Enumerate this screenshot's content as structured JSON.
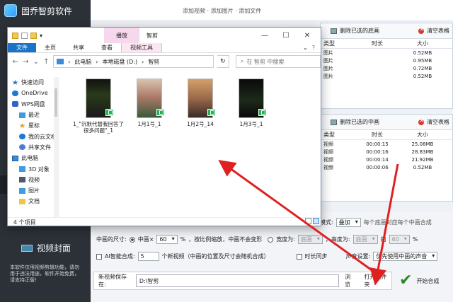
{
  "app": {
    "title": "固乔智剪软件",
    "top_text": "添加视频 · 添加图片 · 添加文件",
    "video_cover_label": "视频封面",
    "side_note": "本软件仅用视频剪辑功能，请勿用于违法用途，软件开始免费，请支持正版!"
  },
  "panel1": {
    "delete_label": "删除已选的底画",
    "clear_label": "清空表格",
    "headers": [
      "类型",
      "时长",
      "大小"
    ],
    "rows": [
      {
        "type": "图片",
        "duration": "",
        "size": "0.52MB"
      },
      {
        "type": "图片",
        "duration": "",
        "size": "0.95MB"
      },
      {
        "type": "图片",
        "duration": "",
        "size": "0.72MB"
      },
      {
        "type": "图片",
        "duration": "",
        "size": "0.52MB"
      }
    ]
  },
  "panel2": {
    "delete_label": "删除已选的中画",
    "clear_label": "清空表格",
    "headers": [
      "类型",
      "时长",
      "大小"
    ],
    "rows": [
      {
        "type": "视频",
        "duration": "00:00:15",
        "size": "25.08MB"
      },
      {
        "type": "视频",
        "duration": "00:00:16",
        "size": "28.83MB"
      },
      {
        "type": "视频",
        "duration": "00:00:14",
        "size": "21.92MB"
      },
      {
        "type": "视频",
        "duration": "00:00:06",
        "size": "0.52MB"
      }
    ]
  },
  "settings": {
    "mode_label": "模式:",
    "mode_value": "叠加",
    "mode_note": "每个底画对应每个中画合成",
    "size_label": "中画的尺寸:",
    "zhonghua_label": "中画×",
    "zhonghua_pct": "60",
    "pct_sign": "%",
    "keep_ratio": "，按比例缩放，中画不会变形",
    "width_label": "宽度为:",
    "width_value": "底画",
    "height_label": "，高度为:",
    "height_value": "底画",
    "of_label": "的",
    "of_value": "60",
    "ai_label": "AI智能合成:",
    "ai_count": "5",
    "ai_note": "个新视频（中画的位置及尺寸会随机合成）",
    "duration_sync": "时长同步",
    "audio_label": "声音设置:",
    "audio_value": "优先使用中画的声音",
    "save_label": "新视频保存在:",
    "save_path": "D:\\智剪",
    "browse_label": "浏览",
    "open_folder_label": "打开文件夹",
    "start_label": "开始合成"
  },
  "explorer": {
    "play_tab": "播放",
    "window_title": "智剪",
    "tabs": [
      "文件",
      "主页",
      "共享",
      "查看",
      "视频工具"
    ],
    "breadcrumb": [
      "此电脑",
      "本地磁盘 (D:)",
      "智剪"
    ],
    "search_placeholder": "在 智剪 中搜索",
    "nav_items": [
      "快速访问",
      "OneDrive",
      "WPS网盘",
      "最近",
      "星标",
      "我的云文档",
      "共享文件",
      "此电脑",
      "3D 对象",
      "视频",
      "图片",
      "文档"
    ],
    "files": [
      {
        "name": "1_\"沉默代替我回答了很多问题\"_1"
      },
      {
        "name": "1月1号_1"
      },
      {
        "name": "1月2号_14"
      },
      {
        "name": "1月3号_1"
      }
    ],
    "status": "4 个项目"
  },
  "colors": {
    "accent_blue": "#1a73c6",
    "annotation_red": "#e02020",
    "start_green": "#2a8a2a"
  }
}
